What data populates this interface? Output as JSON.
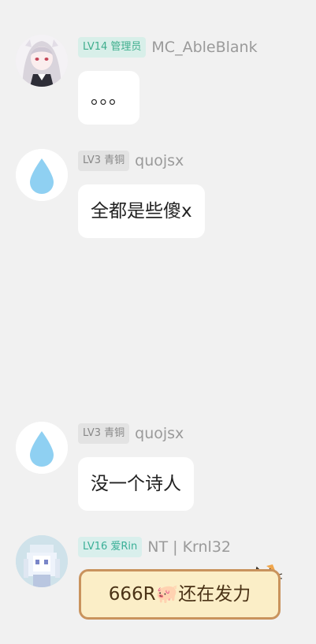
{
  "messages": [
    {
      "level": "LV14",
      "title": "管理员",
      "username": "MC_AbleBlank",
      "text": "。。。",
      "avatar": "anime-girl-avatar"
    },
    {
      "level": "LV3",
      "title": "青铜",
      "username": "quojsx",
      "text": "全都是些傻x",
      "avatar": "water-drop-avatar"
    },
    {
      "level": "LV3",
      "title": "青铜",
      "username": "quojsx",
      "text": "没一个诗人",
      "avatar": "water-drop-avatar"
    },
    {
      "level": "LV16",
      "title": "爱Rin",
      "username": "NT | Krnl32",
      "text_before": "666R",
      "text_after": "还在发力",
      "emoji": "🐖",
      "avatar": "pixel-girl-avatar"
    }
  ],
  "colors": {
    "background": "#f1f1f1",
    "bubble": "#ffffff",
    "admin_badge": "#3fae8d",
    "drop": "#8fd0f2"
  }
}
